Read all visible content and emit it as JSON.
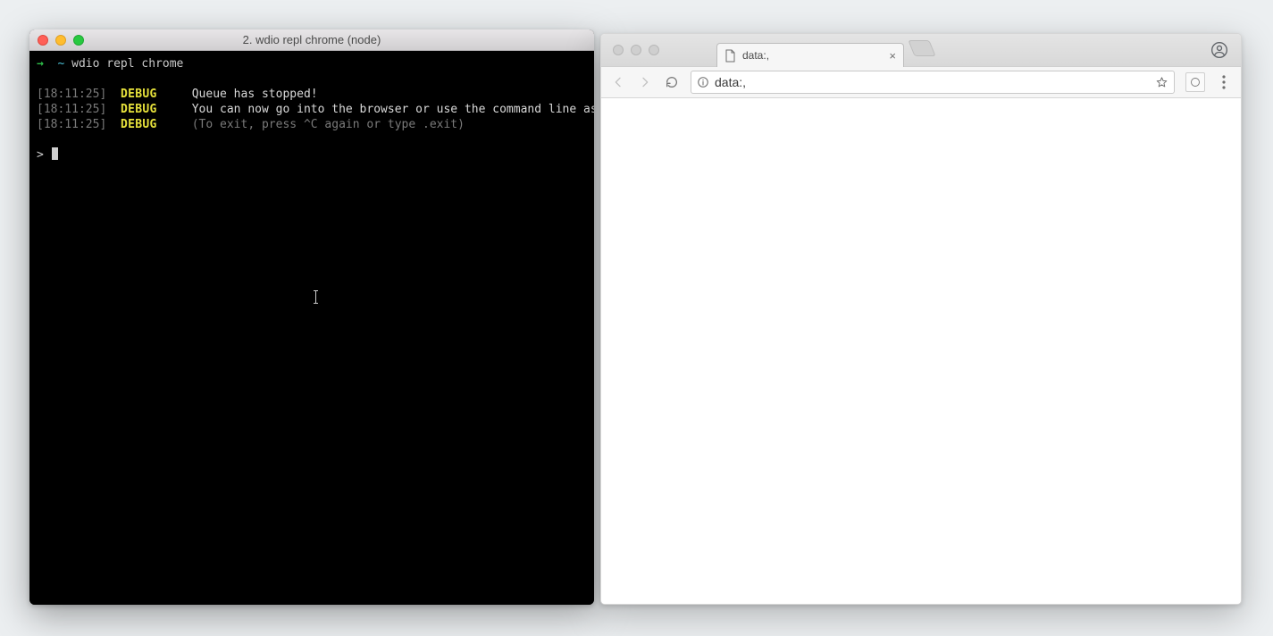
{
  "terminal": {
    "title": "2. wdio repl chrome (node)",
    "prompt_arrow": "→",
    "prompt_tilde": "~",
    "command": "wdio repl chrome",
    "logs": [
      {
        "ts": "[18:11:25]",
        "level": "DEBUG",
        "msg": "Queue has stopped!",
        "tone": "white"
      },
      {
        "ts": "[18:11:25]",
        "level": "DEBUG",
        "msg": "You can now go into the browser or use the command line as REPL",
        "tone": "white"
      },
      {
        "ts": "[18:11:25]",
        "level": "DEBUG",
        "msg": "(To exit, press ^C again or type .exit)",
        "tone": "grey"
      }
    ],
    "repl_prompt": ">"
  },
  "browser": {
    "tab_title": "data:,",
    "url": "data:,"
  }
}
